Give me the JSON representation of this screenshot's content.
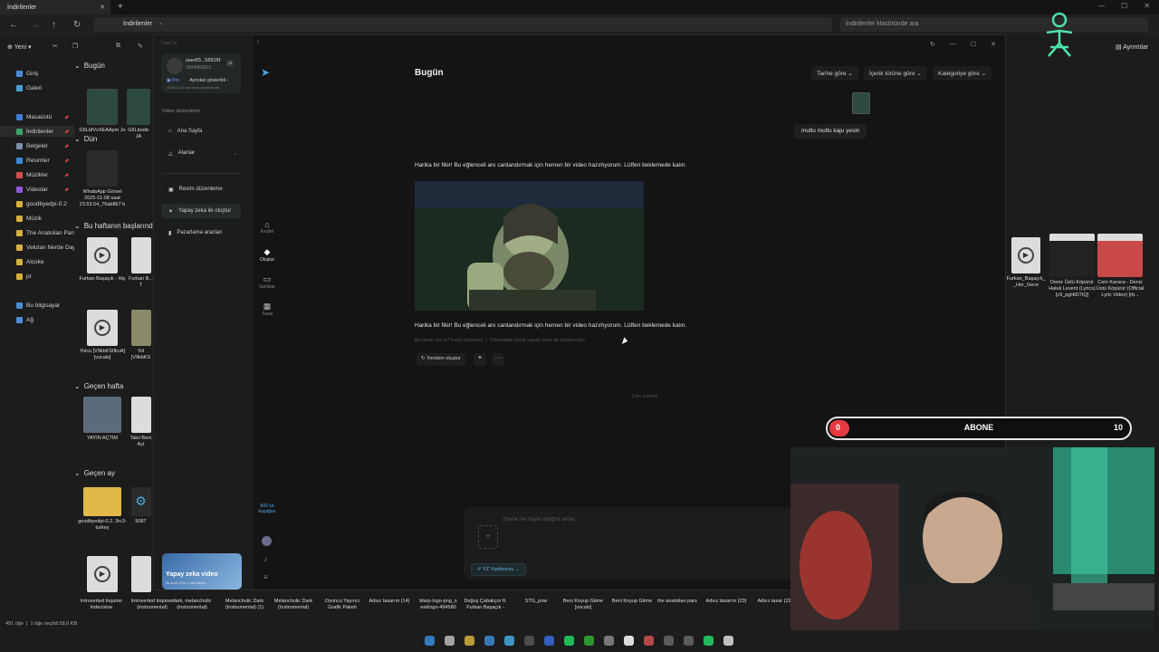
{
  "explorer": {
    "tab_title": "İndirilenler",
    "path": "İndirilenler",
    "search_placeholder": "İndirilenler klasöründe ara",
    "new_label": "Yeni",
    "details_label": "Ayrıntılar",
    "status_left": "491 öğe",
    "status_sel": "1 öğe seçildi 58,0 KB",
    "nav": [
      {
        "label": "Giriş",
        "color": "#4a8cd6"
      },
      {
        "label": "Galeri",
        "color": "#4aa0d6"
      },
      {
        "label": "Masaüstü",
        "color": "#3f7fd0"
      },
      {
        "label": "İndirilenler",
        "color": "#3aa36a"
      },
      {
        "label": "Belgeler",
        "color": "#7a8fa8"
      },
      {
        "label": "Resimler",
        "color": "#3a8ad6"
      },
      {
        "label": "Müzikler",
        "color": "#d05050"
      },
      {
        "label": "Videolar",
        "color": "#8a5ad6"
      },
      {
        "label": "goodbyedpi-0.2",
        "color": "#d6b040"
      },
      {
        "label": "Müzik",
        "color": "#d6b040"
      },
      {
        "label": "The Anatolian Pars",
        "color": "#d6b040"
      },
      {
        "label": "Velutan Nerde Day",
        "color": "#d6b040"
      },
      {
        "label": "Alcoke",
        "color": "#d6b040"
      },
      {
        "label": "pr",
        "color": "#d6b040"
      },
      {
        "label": "Bu bilgisayar",
        "color": "#4a8cd6"
      },
      {
        "label": "Ağ",
        "color": "#4a8cd6"
      }
    ],
    "sections": {
      "today": "Bugün",
      "yesterday": "Dün",
      "this_week": "Bu haftanın başlarında",
      "last_week": "Geçen hafta",
      "last_month": "Geçen ay"
    },
    "files": {
      "today1": "G5LbfVvXEAApm Jo",
      "today2": "G5Lbodic JA",
      "yest1": "WhatsApp Görsel 2025-11-08 saat 23.53.54_76ab867 b",
      "week1": "Furkan Başaçık - Hiç",
      "week2": "Furkan B... T",
      "week3": "Yolcu [V9kbKSIfkuA] [vocals]",
      "week4": "Yol [V9kbKS",
      "lw1": "YAYIN AÇTIM",
      "lw2": "Takıl Beni Açt",
      "lm1": "goodbyedpi-0.2. 3rc3-turkey",
      "lm2": "5087",
      "right1": "Furkan_Başaçık_ _Her_Gece",
      "right2": "Deniz Üstü Köpürür Haluk Levent (Lyrics) [c9_pgHtD7IQ]",
      "right3": "Cem Karaca - Deniz Üstü Köpürür (Official Lyric Video) [rb..."
    },
    "bottom_row": [
      "Introverted Inquirer Indecisive",
      "Introverted Inquirer (instrumental)",
      "dark, melancholic (instrumental)",
      "Melancholic Dark (Instrumental) (1)",
      "Melancholic Dark (Instrumental)",
      "Oyuncu Yayıncı Grafik Paketi",
      "Adsız tasarım (14)",
      "blarp-logo-png_s eeklogo-494580",
      "Doğuş Çabakçor ft. Furkan Başaçık -",
      "STG_pow",
      "Beni Koyup Gitme [vocals]",
      "Beni Koyup Gitme",
      "the anatolian pars",
      "Adsız tasarım (23)",
      "Adsız tasar (22)"
    ]
  },
  "app": {
    "user_name": "user83...56916f",
    "user_id": "0304965913",
    "user_badge": "µt",
    "pro_label": "Pro",
    "pro_text": "Ayından gösterildi",
    "pro_sub": "2026/11/15 tarihinde yenilenecek",
    "section_label": "Video düzenleme",
    "menu": [
      "Ana Sayfa",
      "Alanlar",
      "Resim düzenleme",
      "Yapay zeka ile oluştur",
      "Pazarlama aracları"
    ],
    "rail": [
      "Keşfet",
      "Oluştur",
      "Varlıklar",
      "Tuval"
    ],
    "credits": "843 kd kaşağan",
    "promo_title": "Yapay zeka video",
    "promo_sub": "İlk adım 0'lık 2 otik başla...",
    "heading": "Bugün",
    "filters": [
      "Tarihe göre",
      "İçerik türüne göre",
      "Kategoriye göre"
    ],
    "user_message": "mutlu mutlu kaju yesin",
    "ai_message": "Harika bir fikir! Bu eğlenceli anı canlandırmak için hemen bir video hazırlıyorum. Lütfen beklemede kalın.",
    "credit_note": "Bu işlem için 57 kredi kullanıldı",
    "credit_note2": "Yukarıdaki içerik yapay zeka ile oluşturuldu.",
    "regen_label": "Yeniden oluştur",
    "quote_icon_label": "❝",
    "more_label": "···",
    "end_text": "Tüm sohbet",
    "input_placeholder": "Hana ne hayal ettiğini anlat",
    "assistant_label": "YZ Yardımcısı"
  },
  "overlay": {
    "abone_label": "ABONE",
    "abone_current": "0",
    "abone_goal": "10",
    "abone_fraction": 0.0
  }
}
